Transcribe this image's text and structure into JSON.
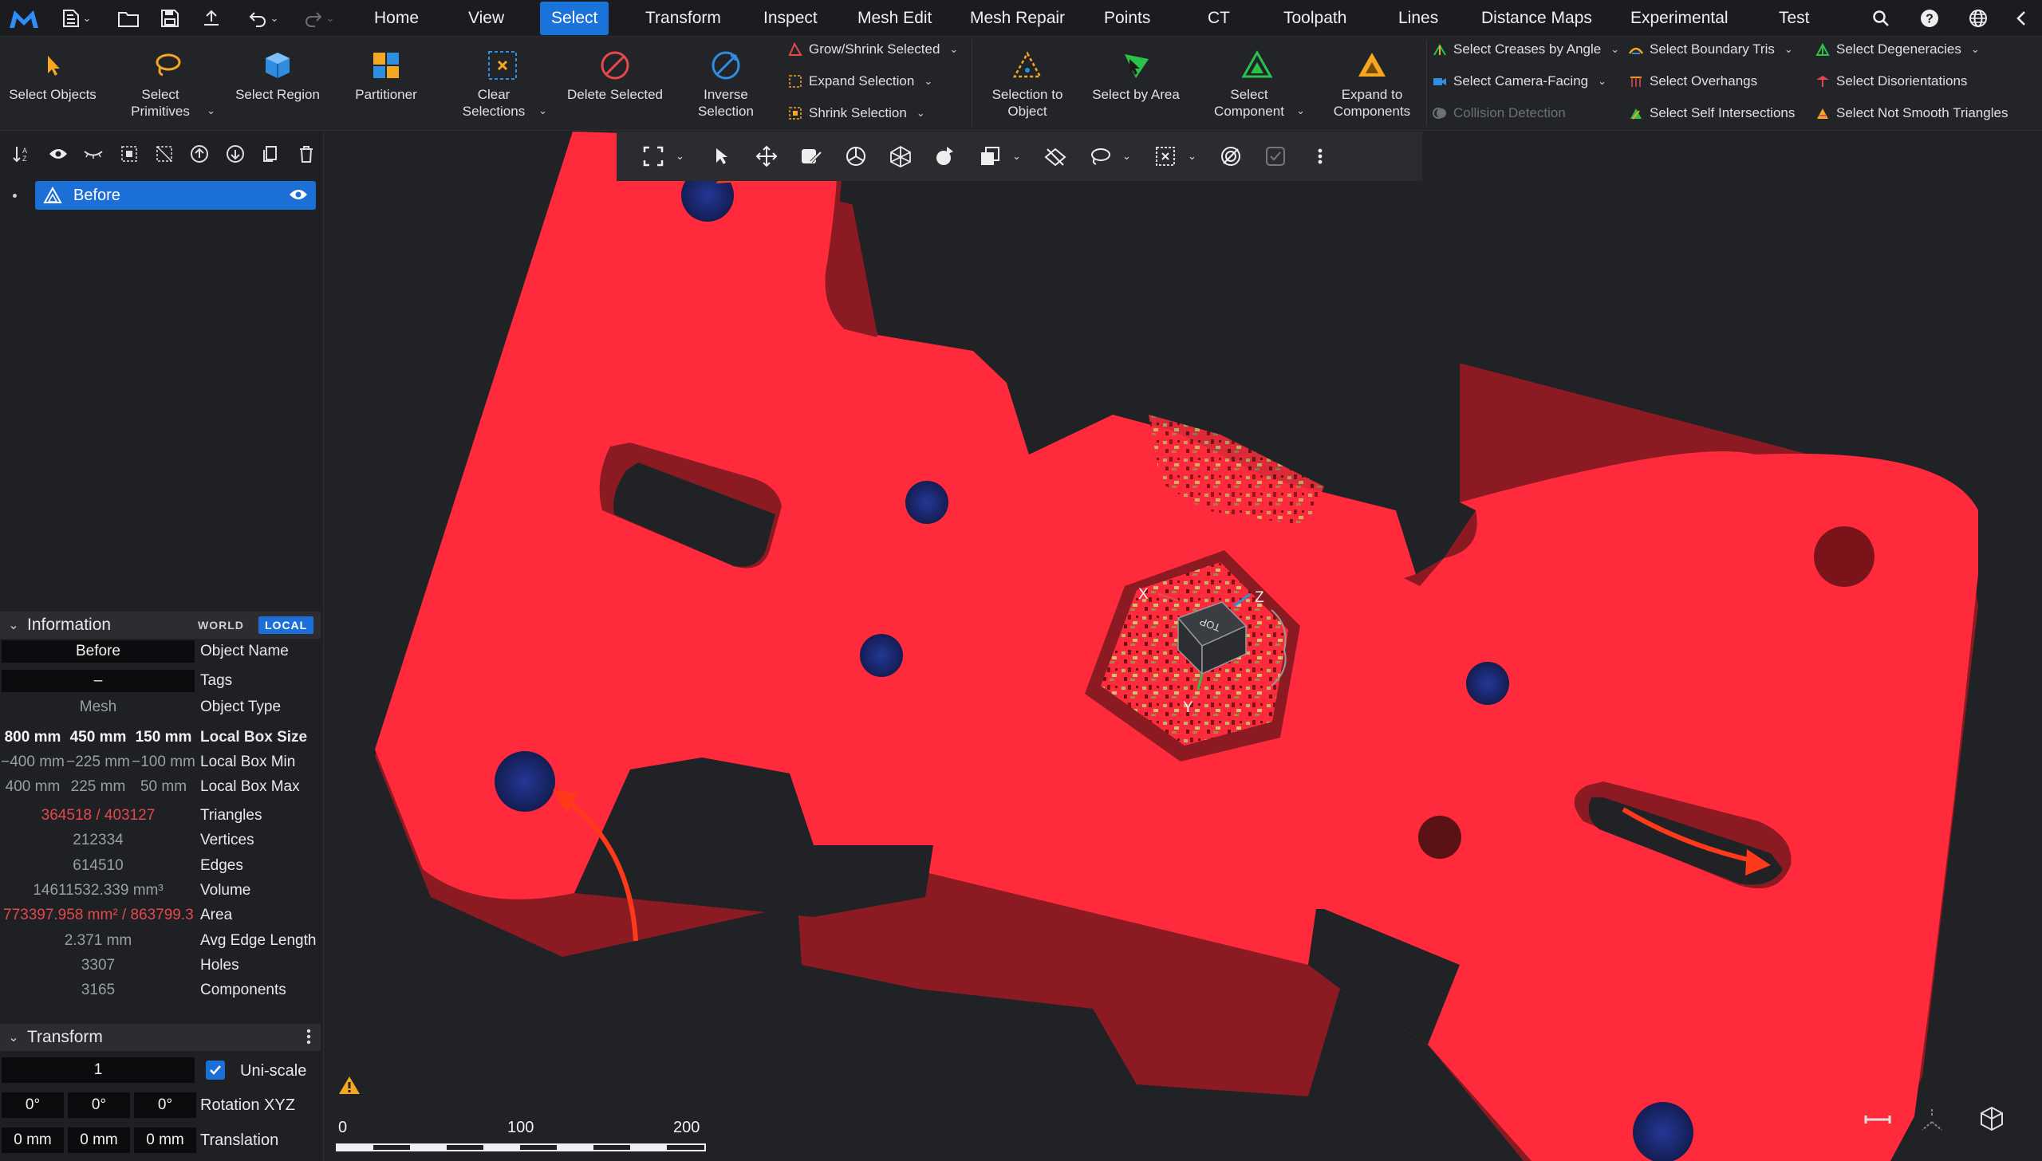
{
  "menubar": {
    "tabs": [
      "Home",
      "View",
      "Select",
      "Transform",
      "Inspect",
      "Mesh Edit",
      "Mesh Repair",
      "Points",
      "CT",
      "Toolpath",
      "Lines",
      "Distance Maps",
      "Experimental",
      "Test"
    ],
    "active_tab": "Select"
  },
  "ribbon": {
    "select_objects": "Select Objects",
    "select_primitives": "Select Primitives",
    "select_region": "Select Region",
    "partitioner": "Partitioner",
    "clear_selections": "Clear Selections",
    "delete_selected": "Delete Selected",
    "inverse_selection": "Inverse Selection",
    "grow_shrink": "Grow/Shrink Selected",
    "expand_selection": "Expand Selection",
    "shrink_selection": "Shrink Selection",
    "selection_to_object": "Selection to Object",
    "select_by_area": "Select by Area",
    "select_component": "Select Component",
    "expand_to_components": "Expand to Components",
    "select_creases": "Select Creases by Angle",
    "select_camera_facing": "Select Camera-Facing",
    "collision_detection": "Collision Detection",
    "select_boundary_tris": "Select Boundary Tris",
    "select_overhangs": "Select Overhangs",
    "select_self_intersections": "Select Self Intersections",
    "select_degeneracies": "Select Degeneracies",
    "select_disorientations": "Select Disorientations",
    "select_not_smooth": "Select Not Smooth Triangles"
  },
  "tree": {
    "object_name": "Before"
  },
  "info": {
    "title": "Information",
    "world": "WORLD",
    "local": "LOCAL",
    "rows": [
      {
        "value": "Before",
        "key": "Object Name"
      },
      {
        "value": "–",
        "key": "Tags"
      },
      {
        "value": "Mesh",
        "key": "Object Type"
      }
    ],
    "box_size": [
      "800 mm",
      "450 mm",
      "150 mm"
    ],
    "box_size_key": "Local Box Size",
    "box_min": [
      "−400 mm",
      "−225 mm",
      "−100 mm"
    ],
    "box_min_key": "Local Box Min",
    "box_max": [
      "400 mm",
      "225 mm",
      "50 mm"
    ],
    "box_max_key": "Local Box Max",
    "stats": [
      {
        "value": "364518 / 403127",
        "key": "Triangles",
        "highlight": true
      },
      {
        "value": "212334",
        "key": "Vertices",
        "highlight": false
      },
      {
        "value": "614510",
        "key": "Edges",
        "highlight": false
      },
      {
        "value": "14611532.339 mm³",
        "key": "Volume",
        "highlight": false
      },
      {
        "value": "773397.958 mm² / 863799.3",
        "key": "Area",
        "highlight": true
      },
      {
        "value": "2.371 mm",
        "key": "Avg Edge Length",
        "highlight": false
      },
      {
        "value": "3307",
        "key": "Holes",
        "highlight": false
      },
      {
        "value": "3165",
        "key": "Components",
        "highlight": false
      }
    ]
  },
  "transform": {
    "title": "Transform",
    "scale": "1",
    "uniscale": "Uni-scale",
    "rotation": [
      "0°",
      "0°",
      "0°"
    ],
    "rotation_key": "Rotation XYZ",
    "translation": [
      "0 mm",
      "0 mm",
      "0 mm"
    ],
    "translation_key": "Translation"
  },
  "viewport": {
    "scale_labels": [
      "0",
      "100",
      "200"
    ],
    "axis_labels": {
      "x": "X",
      "y": "Y",
      "z": "Z"
    },
    "view_cube_face": "TOP"
  },
  "colors": {
    "accent": "#1a73d9",
    "mesh_selected": "#ff2a3b",
    "holes": "#1c2a6b",
    "arrow": "#ff3a1a"
  }
}
